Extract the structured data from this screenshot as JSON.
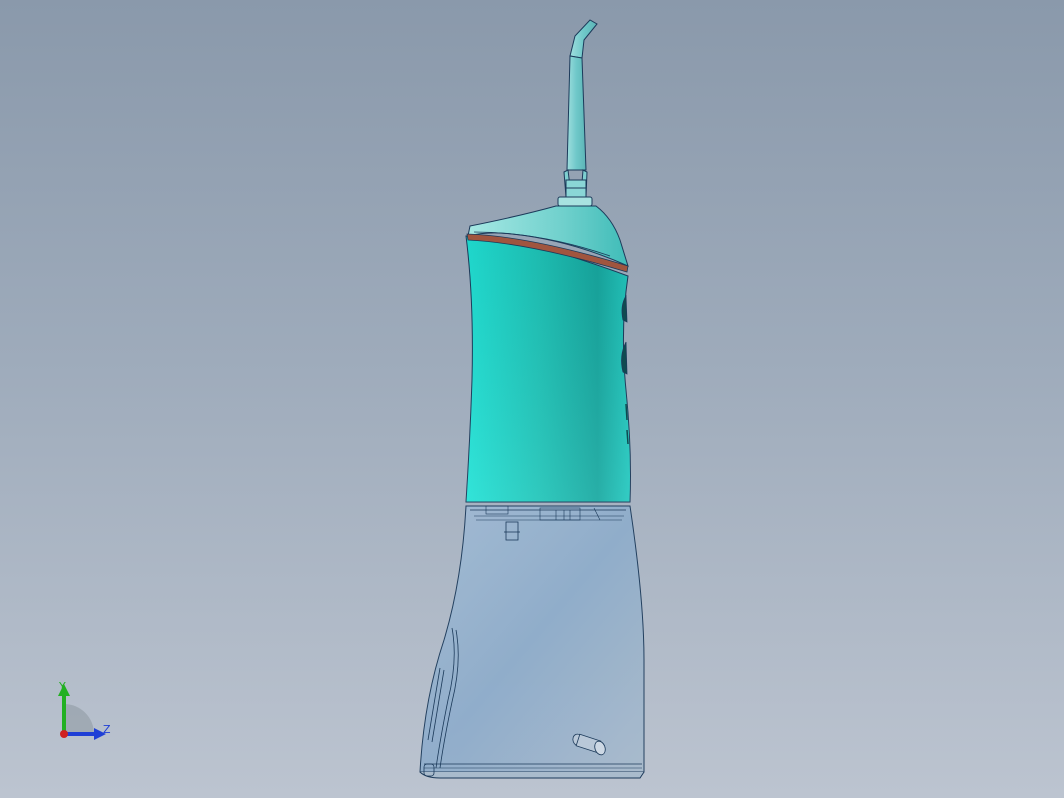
{
  "viewport": {
    "background_top": "#8a99ab",
    "background_bottom": "#bcc4d0"
  },
  "model": {
    "body_color": "#1fc1b6",
    "body_highlight": "#20e2d6",
    "nozzle_color": "#7ecfd0",
    "band_color": "#a0553f",
    "tank_color": "#93acc6",
    "edge_color": "#1c3a5a"
  },
  "triad": {
    "y_label": "Y",
    "z_label": "Z",
    "y_color": "#22b022",
    "z_color": "#1f3fd6",
    "x_color": "#d02020"
  }
}
